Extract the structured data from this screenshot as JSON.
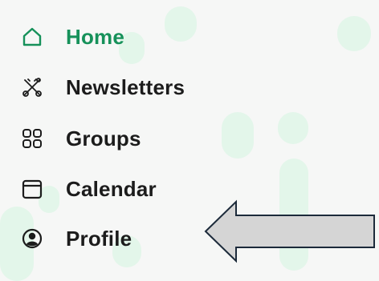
{
  "nav": {
    "items": [
      {
        "label": "Home",
        "icon": "home-icon",
        "active": true
      },
      {
        "label": "Newsletters",
        "icon": "newsletters-icon",
        "active": false
      },
      {
        "label": "Groups",
        "icon": "groups-icon",
        "active": false
      },
      {
        "label": "Calendar",
        "icon": "calendar-icon",
        "active": false
      },
      {
        "label": "Profile",
        "icon": "profile-icon",
        "active": false
      }
    ]
  },
  "colors": {
    "accent": "#16915a",
    "text": "#1c1c1c",
    "background": "#f6f7f6",
    "decoration": "#e3f6ea",
    "pointer_arrow_fill": "#d5d5d5",
    "pointer_arrow_stroke": "#1c2a3a"
  },
  "annotation": {
    "pointer_arrow": "left-pointing arrow indicating Profile"
  }
}
